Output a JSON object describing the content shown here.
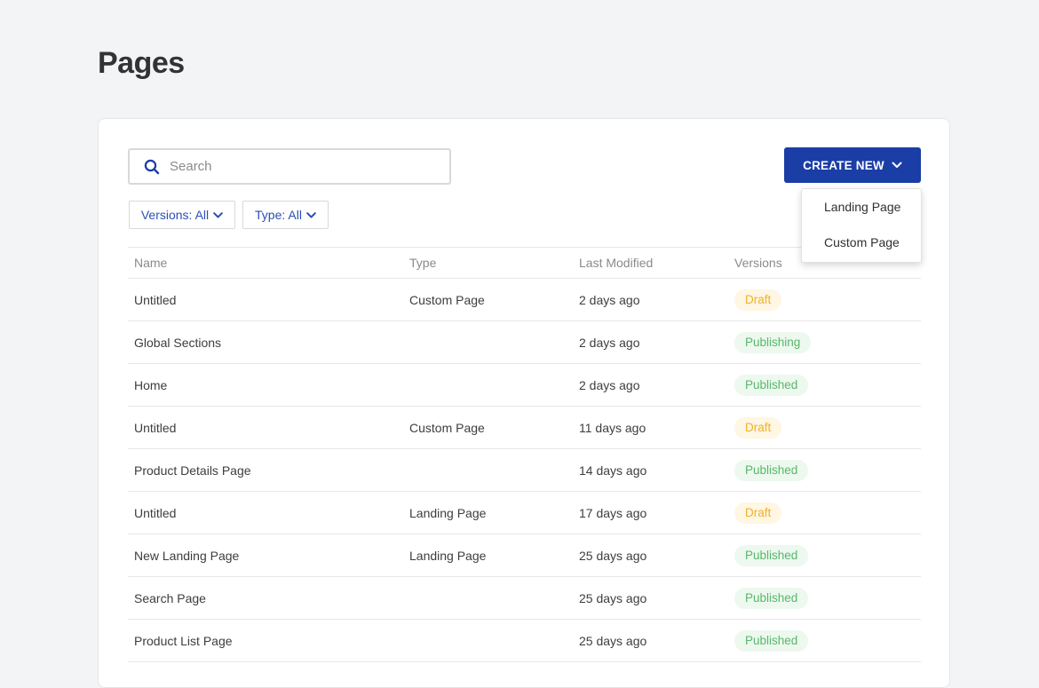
{
  "page": {
    "title": "Pages"
  },
  "search": {
    "placeholder": "Search",
    "value": ""
  },
  "create_new": {
    "label": "CREATE NEW",
    "menu": [
      "Landing Page",
      "Custom Page"
    ]
  },
  "filters": {
    "versions": "Versions: All",
    "type": "Type: All"
  },
  "table": {
    "columns": [
      "Name",
      "Type",
      "Last Modified",
      "Versions"
    ],
    "rows": [
      {
        "name": "Untitled",
        "type": "Custom Page",
        "modified": "2 days ago",
        "version": "Draft",
        "status": "draft"
      },
      {
        "name": "Global Sections",
        "type": "",
        "modified": "2 days ago",
        "version": "Publishing",
        "status": "publishing"
      },
      {
        "name": "Home",
        "type": "",
        "modified": "2 days ago",
        "version": "Published",
        "status": "published"
      },
      {
        "name": "Untitled",
        "type": "Custom Page",
        "modified": "11 days ago",
        "version": "Draft",
        "status": "draft"
      },
      {
        "name": "Product Details Page",
        "type": "",
        "modified": "14 days ago",
        "version": "Published",
        "status": "published"
      },
      {
        "name": "Untitled",
        "type": "Landing Page",
        "modified": "17 days ago",
        "version": "Draft",
        "status": "draft"
      },
      {
        "name": "New Landing Page",
        "type": "Landing Page",
        "modified": "25 days ago",
        "version": "Published",
        "status": "published"
      },
      {
        "name": "Search Page",
        "type": "",
        "modified": "25 days ago",
        "version": "Published",
        "status": "published"
      },
      {
        "name": "Product List Page",
        "type": "",
        "modified": "25 days ago",
        "version": "Published",
        "status": "published"
      }
    ]
  },
  "colors": {
    "accent": "#1a3ea6",
    "filter_text": "#2c4fb6",
    "draft_bg": "#fff6e3",
    "draft_text": "#f0b028",
    "published_bg": "#edf8ef",
    "published_text": "#58b86a"
  },
  "icons": {
    "search": "search-icon",
    "create_chevron": "chevron-down-icon",
    "filter_chevron": "chevron-down-icon"
  }
}
